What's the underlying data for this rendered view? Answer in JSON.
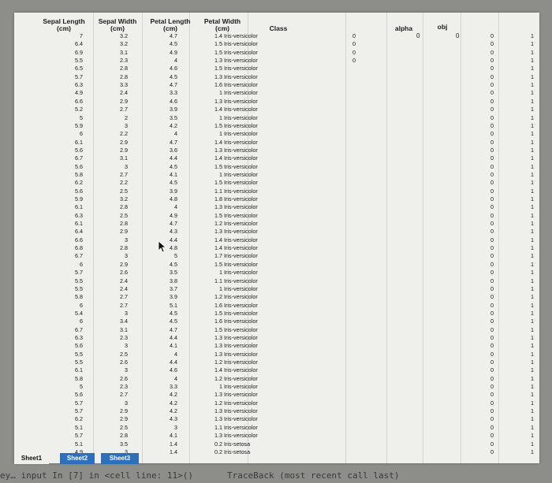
{
  "headers": {
    "sepal_length": "Sepal Length (cm)",
    "sepal_width": "Sepal Width (cm)",
    "petal_length": "Petal Length (cm)",
    "petal_width": "Petal Width (cm)",
    "class": "Class",
    "alpha": "alpha",
    "obj": "obj"
  },
  "alpha_value": "0",
  "obj_value": "0",
  "rows": [
    [
      "7",
      "3.2",
      "4.7",
      "1.4",
      "Iris-versicolor",
      "0",
      "0",
      "1"
    ],
    [
      "6.4",
      "3.2",
      "4.5",
      "1.5",
      "Iris-versicolor",
      "0",
      "0",
      "1"
    ],
    [
      "6.9",
      "3.1",
      "4.9",
      "1.5",
      "Iris-versicolor",
      "0",
      "0",
      "1"
    ],
    [
      "5.5",
      "2.3",
      "4",
      "1.3",
      "Iris-versicolor",
      "0",
      "0",
      "1"
    ],
    [
      "6.5",
      "2.8",
      "4.6",
      "1.5",
      "Iris-versicolor",
      "",
      "0",
      "1"
    ],
    [
      "5.7",
      "2.8",
      "4.5",
      "1.3",
      "Iris-versicolor",
      "",
      "0",
      "1"
    ],
    [
      "6.3",
      "3.3",
      "4.7",
      "1.6",
      "Iris-versicolor",
      "",
      "0",
      "1"
    ],
    [
      "4.9",
      "2.4",
      "3.3",
      "1",
      "Iris-versicolor",
      "",
      "0",
      "1"
    ],
    [
      "6.6",
      "2.9",
      "4.6",
      "1.3",
      "Iris-versicolor",
      "",
      "0",
      "1"
    ],
    [
      "5.2",
      "2.7",
      "3.9",
      "1.4",
      "Iris-versicolor",
      "",
      "0",
      "1"
    ],
    [
      "5",
      "2",
      "3.5",
      "1",
      "Iris-versicolor",
      "",
      "0",
      "1"
    ],
    [
      "5.9",
      "3",
      "4.2",
      "1.5",
      "Iris-versicolor",
      "",
      "0",
      "1"
    ],
    [
      "6",
      "2.2",
      "4",
      "1",
      "Iris-versicolor",
      "",
      "0",
      "1"
    ],
    [
      "6.1",
      "2.9",
      "4.7",
      "1.4",
      "Iris-versicolor",
      "",
      "0",
      "1"
    ],
    [
      "5.6",
      "2.9",
      "3.6",
      "1.3",
      "Iris-versicolor",
      "",
      "0",
      "1"
    ],
    [
      "6.7",
      "3.1",
      "4.4",
      "1.4",
      "Iris-versicolor",
      "",
      "0",
      "1"
    ],
    [
      "5.6",
      "3",
      "4.5",
      "1.5",
      "Iris-versicolor",
      "",
      "0",
      "1"
    ],
    [
      "5.8",
      "2.7",
      "4.1",
      "1",
      "Iris-versicolor",
      "",
      "0",
      "1"
    ],
    [
      "6.2",
      "2.2",
      "4.5",
      "1.5",
      "Iris-versicolor",
      "",
      "0",
      "1"
    ],
    [
      "5.6",
      "2.5",
      "3.9",
      "1.1",
      "Iris-versicolor",
      "",
      "0",
      "1"
    ],
    [
      "5.9",
      "3.2",
      "4.8",
      "1.8",
      "Iris-versicolor",
      "",
      "0",
      "1"
    ],
    [
      "6.1",
      "2.8",
      "4",
      "1.3",
      "Iris-versicolor",
      "",
      "0",
      "1"
    ],
    [
      "6.3",
      "2.5",
      "4.9",
      "1.5",
      "Iris-versicolor",
      "",
      "0",
      "1"
    ],
    [
      "6.1",
      "2.8",
      "4.7",
      "1.2",
      "Iris-versicolor",
      "",
      "0",
      "1"
    ],
    [
      "6.4",
      "2.9",
      "4.3",
      "1.3",
      "Iris-versicolor",
      "",
      "0",
      "1"
    ],
    [
      "6.6",
      "3",
      "4.4",
      "1.4",
      "Iris-versicolor",
      "",
      "0",
      "1"
    ],
    [
      "6.8",
      "2.8",
      "4.8",
      "1.4",
      "Iris-versicolor",
      "",
      "0",
      "1"
    ],
    [
      "6.7",
      "3",
      "5",
      "1.7",
      "Iris-versicolor",
      "",
      "0",
      "1"
    ],
    [
      "6",
      "2.9",
      "4.5",
      "1.5",
      "Iris-versicolor",
      "",
      "0",
      "1"
    ],
    [
      "5.7",
      "2.6",
      "3.5",
      "1",
      "Iris-versicolor",
      "",
      "0",
      "1"
    ],
    [
      "5.5",
      "2.4",
      "3.8",
      "1.1",
      "Iris-versicolor",
      "",
      "0",
      "1"
    ],
    [
      "5.5",
      "2.4",
      "3.7",
      "1",
      "Iris-versicolor",
      "",
      "0",
      "1"
    ],
    [
      "5.8",
      "2.7",
      "3.9",
      "1.2",
      "Iris-versicolor",
      "",
      "0",
      "1"
    ],
    [
      "6",
      "2.7",
      "5.1",
      "1.6",
      "Iris-versicolor",
      "",
      "0",
      "1"
    ],
    [
      "5.4",
      "3",
      "4.5",
      "1.5",
      "Iris-versicolor",
      "",
      "0",
      "1"
    ],
    [
      "6",
      "3.4",
      "4.5",
      "1.6",
      "Iris-versicolor",
      "",
      "0",
      "1"
    ],
    [
      "6.7",
      "3.1",
      "4.7",
      "1.5",
      "Iris-versicolor",
      "",
      "0",
      "1"
    ],
    [
      "6.3",
      "2.3",
      "4.4",
      "1.3",
      "Iris-versicolor",
      "",
      "0",
      "1"
    ],
    [
      "5.6",
      "3",
      "4.1",
      "1.3",
      "Iris-versicolor",
      "",
      "0",
      "1"
    ],
    [
      "5.5",
      "2.5",
      "4",
      "1.3",
      "Iris-versicolor",
      "",
      "0",
      "1"
    ],
    [
      "5.5",
      "2.6",
      "4.4",
      "1.2",
      "Iris-versicolor",
      "",
      "0",
      "1"
    ],
    [
      "6.1",
      "3",
      "4.6",
      "1.4",
      "Iris-versicolor",
      "",
      "0",
      "1"
    ],
    [
      "5.8",
      "2.6",
      "4",
      "1.2",
      "Iris-versicolor",
      "",
      "0",
      "1"
    ],
    [
      "5",
      "2.3",
      "3.3",
      "1",
      "Iris-versicolor",
      "",
      "0",
      "1"
    ],
    [
      "5.6",
      "2.7",
      "4.2",
      "1.3",
      "Iris-versicolor",
      "",
      "0",
      "1"
    ],
    [
      "5.7",
      "3",
      "4.2",
      "1.2",
      "Iris-versicolor",
      "",
      "0",
      "1"
    ],
    [
      "5.7",
      "2.9",
      "4.2",
      "1.3",
      "Iris-versicolor",
      "",
      "0",
      "1"
    ],
    [
      "6.2",
      "2.9",
      "4.3",
      "1.3",
      "Iris-versicolor",
      "",
      "0",
      "1"
    ],
    [
      "5.1",
      "2.5",
      "3",
      "1.1",
      "Iris-versicolor",
      "",
      "0",
      "1"
    ],
    [
      "5.7",
      "2.8",
      "4.1",
      "1.3",
      "Iris-versicolor",
      "",
      "0",
      "1"
    ],
    [
      "5.1",
      "3.5",
      "1.4",
      "0.2",
      "Iris-setosa",
      "",
      "0",
      "1"
    ],
    [
      "4.9",
      "3",
      "1.4",
      "0.2",
      "Iris-setosa",
      "",
      "0",
      "1"
    ]
  ],
  "tabs": [
    "Sheet1",
    "Sheet2",
    "Sheet3"
  ],
  "bottom_left_text": "ey… input In [7] in <cell line: 11>()",
  "bottom_right_text": "TraceBack (most recent call last)"
}
